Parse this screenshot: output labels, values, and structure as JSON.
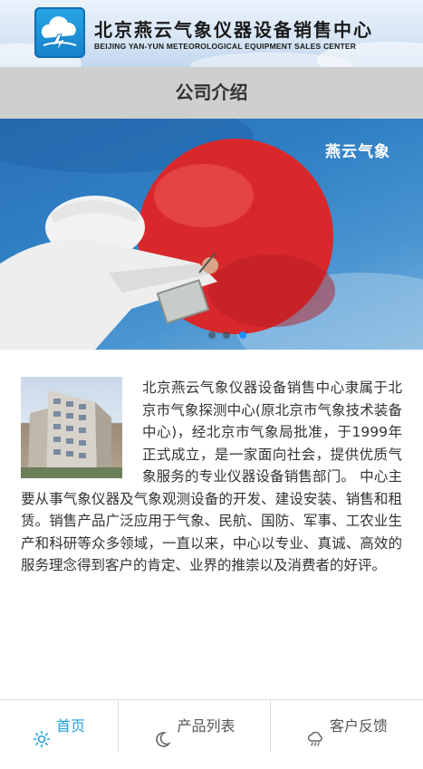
{
  "header": {
    "company_name_cn": "北京燕云气象仪器设备销售中心",
    "company_name_en": "BEIJING YAN-YUN METEOROLOGICAL EQUIPMENT SALES CENTER",
    "logo_icon": "cloud-lightning-logo-icon"
  },
  "section": {
    "title": "公司介绍"
  },
  "banner": {
    "brand_text": "燕云气象",
    "slide_count": 3,
    "active_slide": 3
  },
  "about": {
    "image_icon": "office-building-photo",
    "text": "北京燕云气象仪器设备销售中心隶属于北京市气象探测中心(原北京市气象技术装备中心)，经北京市气象局批准，于1999年正式成立，是一家面向社会，提供优质气象服务的专业仪器设备销售部门。 中心主要从事气象仪器及气象观测设备的开发、建设安装、销售和租赁。销售产品广泛应用于气象、民航、国防、军事、工农业生产和科研等众多领域，一直以来，中心以专业、真诚、高效的服务理念得到客户的肯定、业界的推崇以及消费者的好评。"
  },
  "bottom_nav": {
    "items": [
      {
        "label": "首页",
        "icon": "sun-icon",
        "active": true
      },
      {
        "label": "产品列表",
        "icon": "moon-icon",
        "active": false
      },
      {
        "label": "客户反馈",
        "icon": "cloud-rain-icon",
        "active": false
      }
    ]
  },
  "colors": {
    "accent": "#1ea0e6",
    "title_bar_bg": "#cfcfcf",
    "text": "#333333",
    "active_dot": "#1e90ff"
  }
}
